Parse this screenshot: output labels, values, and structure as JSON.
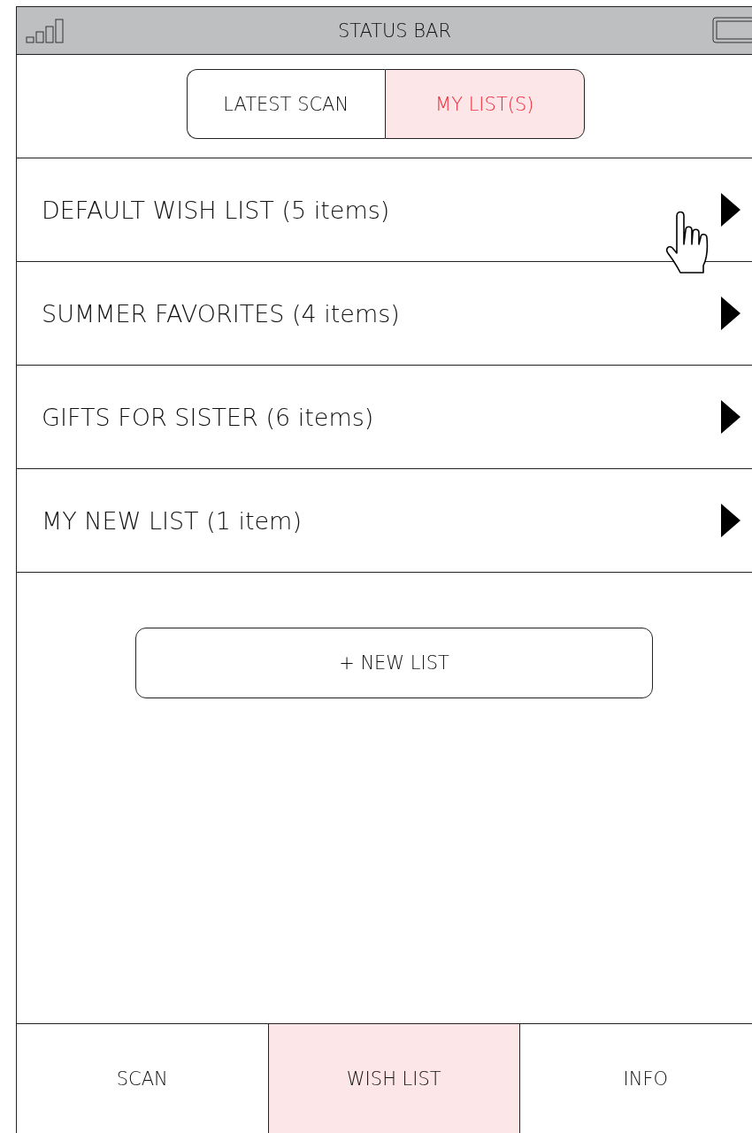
{
  "status_bar": {
    "title": "STATUS BAR"
  },
  "segments": [
    {
      "label": "LATEST SCAN",
      "selected": false
    },
    {
      "label": "MY LIST(S)",
      "selected": true
    }
  ],
  "lists": [
    {
      "label": "DEFAULT WISH LIST (5 items)",
      "hovered": true
    },
    {
      "label": "SUMMER FAVORITES (4 items)",
      "hovered": false
    },
    {
      "label": "GIFTS FOR SISTER (6 items)",
      "hovered": false
    },
    {
      "label": "MY NEW LIST (1 item)",
      "hovered": false
    }
  ],
  "new_list_button": "+ NEW LIST",
  "tab_bar": [
    {
      "label": "SCAN",
      "selected": false
    },
    {
      "label": "WISH LIST",
      "selected": true
    },
    {
      "label": "INFO",
      "selected": false
    }
  ]
}
